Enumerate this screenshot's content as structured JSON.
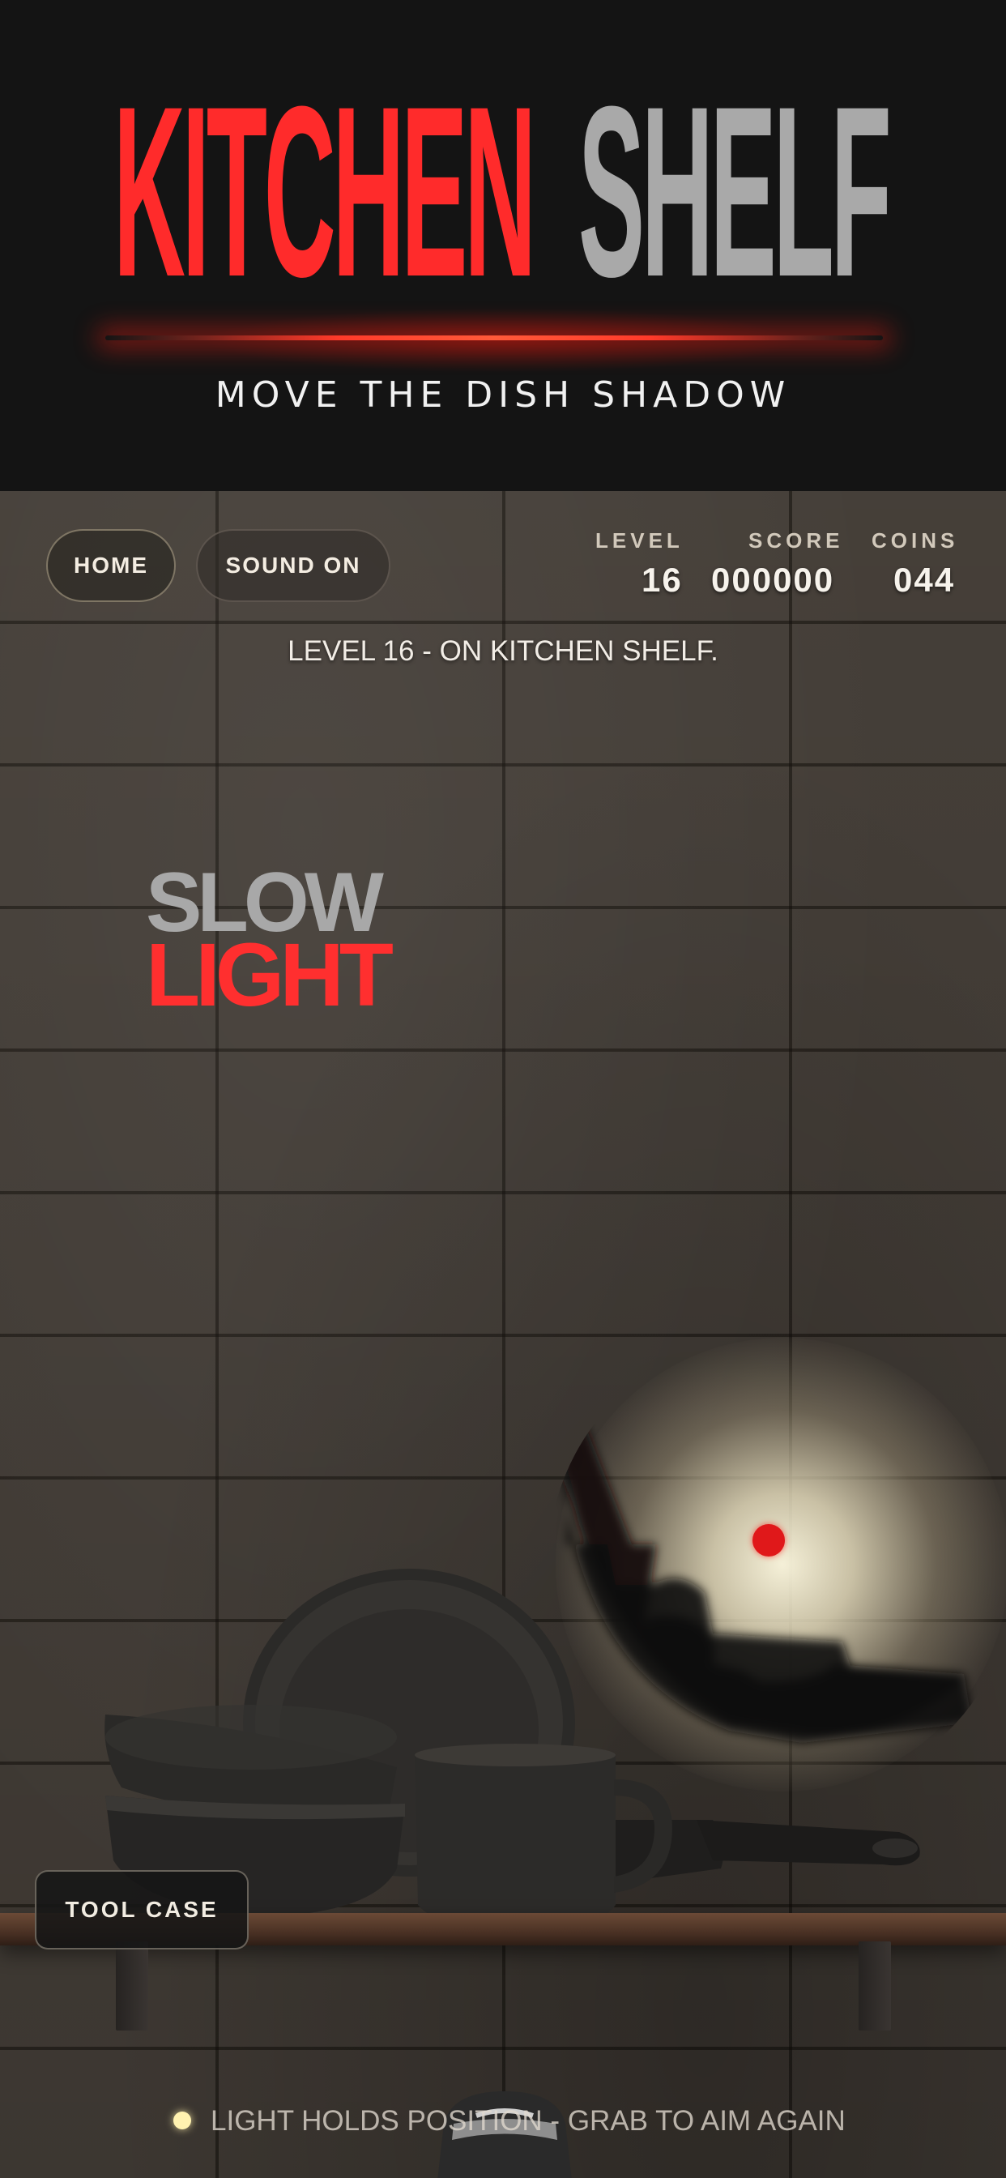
{
  "header": {
    "title_part1": "KITCHEN",
    "title_part2": "SHELF",
    "subtitle": "MOVE THE DISH SHADOW",
    "title_part1_color": "#ff2b2b",
    "title_part2_color": "#a9a9a9"
  },
  "hud": {
    "home_label": "HOME",
    "sound_label": "SOUND ON",
    "level_label": "LEVEL",
    "level_value": "16",
    "score_label": "SCORE",
    "score_value": "000000",
    "coins_label": "COINS",
    "coins_value": "044"
  },
  "scene": {
    "level_caption": "LEVEL 16 - ON KITCHEN SHELF.",
    "badge_line1": "SLOW",
    "badge_line2": "LIGHT",
    "tool_case_label": "TOOL CASE",
    "hint_text": "LIGHT HOLDS POSITION - GRAB TO AIM AGAIN",
    "objects": [
      "plate",
      "bowl",
      "bowl",
      "mug",
      "skillet"
    ],
    "accent_color": "#e0181a"
  }
}
